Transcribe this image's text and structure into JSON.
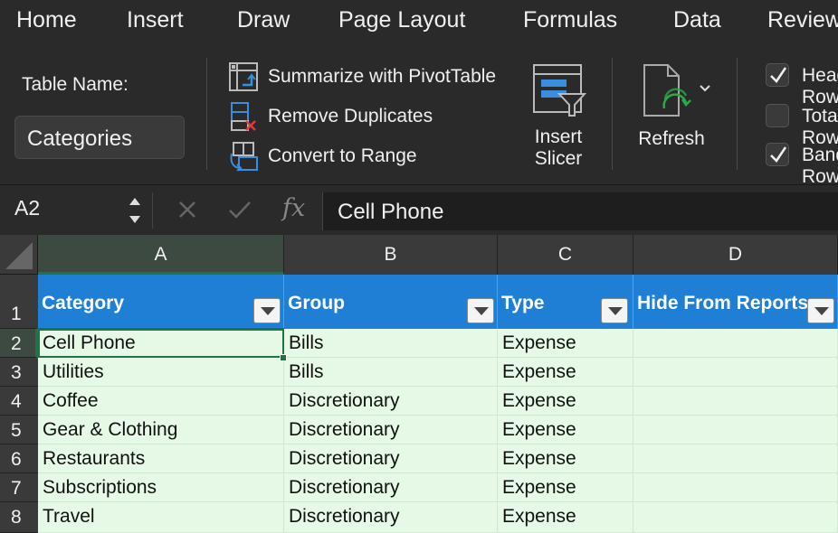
{
  "ribbon_tabs": [
    "Home",
    "Insert",
    "Draw",
    "Page Layout",
    "Formulas",
    "Data",
    "Review"
  ],
  "ribbon": {
    "table_name_label": "Table Name:",
    "table_name_value": "Categories",
    "tools": {
      "summarize": "Summarize with PivotTable",
      "remove_duplicates": "Remove Duplicates",
      "convert_to_range": "Convert to Range"
    },
    "insert_slicer": [
      "Insert",
      "Slicer"
    ],
    "refresh": "Refresh",
    "options": [
      {
        "label": "Header Row",
        "checked": true
      },
      {
        "label": "Total Row",
        "checked": false
      },
      {
        "label": "Banded Rows",
        "checked": true
      }
    ]
  },
  "formula_bar": {
    "name_box": "A2",
    "cancel_icon": "x-icon",
    "enter_icon": "check-icon",
    "fx_label": "fx",
    "formula": "Cell Phone"
  },
  "sheet": {
    "columns": [
      "A",
      "B",
      "C",
      "D"
    ],
    "selected_column": "A",
    "row_numbers": [
      "1",
      "2",
      "3",
      "4",
      "5",
      "6",
      "7",
      "8"
    ],
    "selected_row": "2",
    "active_cell": "A2",
    "header": [
      "Category",
      "Group",
      "Type",
      "Hide From Reports"
    ],
    "rows": [
      [
        "Cell Phone",
        "Bills",
        "Expense",
        ""
      ],
      [
        "Utilities",
        "Bills",
        "Expense",
        ""
      ],
      [
        "Coffee",
        "Discretionary",
        "Expense",
        ""
      ],
      [
        "Gear & Clothing",
        "Discretionary",
        "Expense",
        ""
      ],
      [
        "Restaurants",
        "Discretionary",
        "Expense",
        ""
      ],
      [
        "Subscriptions",
        "Discretionary",
        "Expense",
        ""
      ],
      [
        "Travel",
        "Discretionary",
        "Expense",
        ""
      ]
    ]
  },
  "colors": {
    "accent_green": "#217346",
    "table_header_blue": "#1e7fd4",
    "band_green": "#e6f8e6",
    "ribbon_bg": "#2a2a2a"
  }
}
